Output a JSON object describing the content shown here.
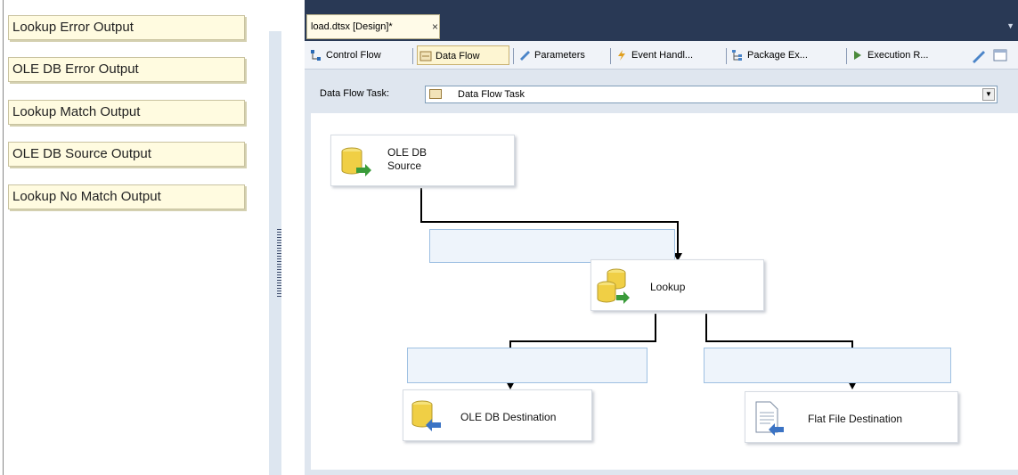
{
  "choices": [
    "Lookup Error Output",
    "OLE DB Error Output",
    "Lookup Match Output",
    "OLE DB Source Output",
    "Lookup No Match Output"
  ],
  "document_tab": {
    "title": "load.dtsx [Design]*",
    "close": "×"
  },
  "designer_tabs": [
    {
      "label": "Control Flow",
      "icon": "control-flow-icon"
    },
    {
      "label": "Data Flow",
      "icon": "data-flow-icon",
      "active": true
    },
    {
      "label": "Parameters",
      "icon": "parameters-icon"
    },
    {
      "label": "Event Handl...",
      "icon": "event-handler-icon"
    },
    {
      "label": "Package Ex...",
      "icon": "package-explorer-icon"
    },
    {
      "label": "Execution R...",
      "icon": "execution-results-icon"
    }
  ],
  "task_selector": {
    "label": "Data Flow Task:",
    "value": "Data Flow Task"
  },
  "components": {
    "source": {
      "line1": "OLE DB",
      "line2": "Source",
      "icon": "database-source-icon"
    },
    "lookup": {
      "label": "Lookup",
      "icon": "lookup-icon"
    },
    "oledb_destination": {
      "label": "OLE DB Destination",
      "icon": "database-destination-icon"
    },
    "flatfile_destination": {
      "label": "Flat File Destination",
      "icon": "flat-file-icon"
    }
  },
  "colors": {
    "tabbar": "#293955",
    "designer_bg": "#dfe6ef",
    "answer_box": "#fffbe0",
    "slot": "#eef4fb"
  }
}
